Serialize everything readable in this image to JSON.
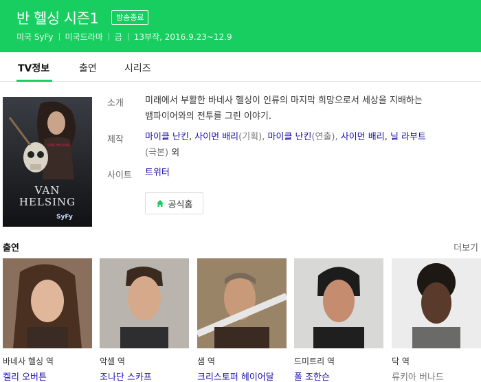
{
  "header": {
    "title": "반 헬싱 시즌1",
    "badge": "방송종료",
    "meta": [
      "미국 SyFy",
      "미국드라마",
      "금",
      "13부작, 2016.9.23~12.9"
    ],
    "accent_color": "#19ce60"
  },
  "tabs": [
    {
      "label": "TV정보",
      "active": true
    },
    {
      "label": "출연",
      "active": false
    },
    {
      "label": "시리즈",
      "active": false
    }
  ],
  "poster": {
    "title_line1": "VAN",
    "title_line2": "HELSING",
    "network": "SyFy"
  },
  "info": {
    "intro_label": "소개",
    "intro_line1": "미래에서 부활한 바네사 헬싱이 인류의 마지막 희망으로서 세상을 지배하는",
    "intro_line2": "뱀파이어와의 전투를 그린 이야기.",
    "prod_label": "제작",
    "prod": {
      "p1": "마이클 난킨",
      "p2": "사이먼 배리",
      "p2_role": "(기획),",
      "p3": "마이클 난킨",
      "p3_role": "(연출),",
      "p4": "사이먼 배리",
      "p5": "닐 라부트",
      "p5_role": "(극본)",
      "suffix": "외"
    },
    "site_label": "사이트",
    "site_link": "트위터",
    "home_button": "공식홈"
  },
  "cast_section": {
    "title": "출연",
    "more": "더보기"
  },
  "cast": [
    {
      "role": "바네사 헬싱 역",
      "actor": "켈리 오버튼",
      "link": true
    },
    {
      "role": "악셀 역",
      "actor": "조나단 스카프",
      "link": true
    },
    {
      "role": "샘 역",
      "actor": "크리스토퍼 헤이어달",
      "link": true
    },
    {
      "role": "드미트리 역",
      "actor": "폴 조한슨",
      "link": true
    },
    {
      "role": "닥 역",
      "actor": "류키아 버나드",
      "link": false
    }
  ]
}
